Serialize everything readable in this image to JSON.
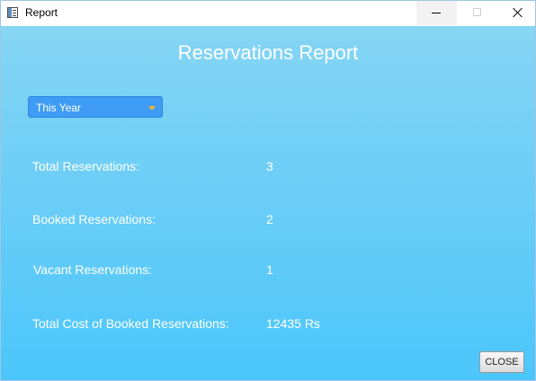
{
  "window": {
    "title": "Report",
    "icon": "app-window-icon"
  },
  "report": {
    "title": "Reservations Report",
    "period_select": {
      "value": "This Year"
    },
    "rows": [
      {
        "label": "Total Reservations:",
        "value": "3"
      },
      {
        "label": "Booked Reservations:",
        "value": "2"
      },
      {
        "label": "Vacant Reservations:",
        "value": "1"
      },
      {
        "label": "Total Cost of Booked Reservations:",
        "value": "12435 Rs"
      }
    ],
    "close_label": "CLOSE"
  },
  "colors": {
    "background_top": "#86d5f3",
    "background_bottom": "#4bc6fb",
    "select_background": "#3f9cf4",
    "select_arrow": "#f0b13a",
    "text": "#ffffff"
  }
}
